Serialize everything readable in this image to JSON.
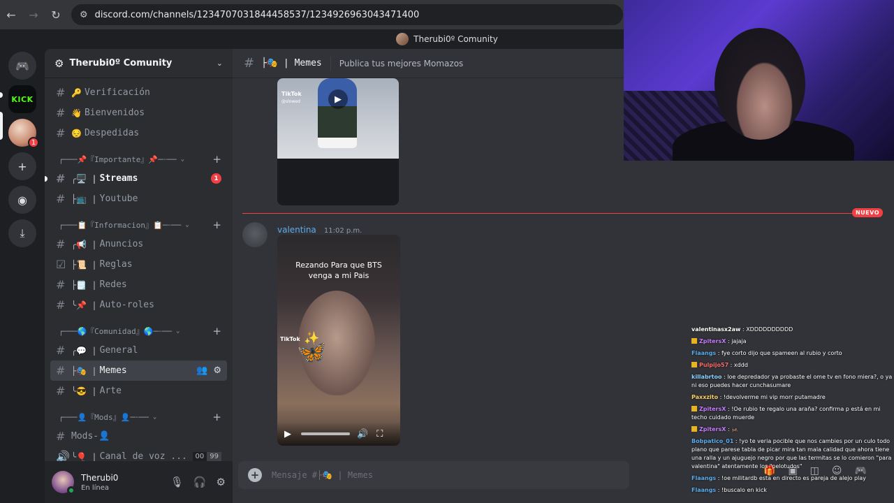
{
  "browser": {
    "url": "discord.com/channels/1234707031844458537/1234926963043471400"
  },
  "window": {
    "title": "Therubi0º Comunity"
  },
  "server": {
    "name": "Therubi0º Comunity"
  },
  "rail": {
    "kick_label": "KICK",
    "badge_count": "1"
  },
  "channels_top": [
    {
      "deco": "🔑",
      "name": "Verificación"
    },
    {
      "deco": "👋",
      "name": "Bienvenidos"
    },
    {
      "deco": "😔",
      "name": "Despedidas"
    }
  ],
  "categories": {
    "importante": "┌───📌『Importante』📌─┈──",
    "informacion": "┌───📋『Informacion』📋─┈──",
    "comunidad": "┌───🌎『Comunidad』🌎─┈──",
    "mods": "┌───👤『Mods』👤─┈──"
  },
  "channels_importante": [
    {
      "deco": "╭🖥️ |",
      "name": "Streams",
      "badge": "1"
    },
    {
      "deco": "├📺 |",
      "name": "Youtube"
    }
  ],
  "channels_informacion": [
    {
      "deco": "╭📢 |",
      "name": "Anuncios"
    },
    {
      "deco": "├📜 |",
      "name": "Reglas"
    },
    {
      "deco": "├🗒️ |",
      "name": "Redes"
    },
    {
      "deco": "╰📌 |",
      "name": "Auto-roles"
    }
  ],
  "channels_comunidad": [
    {
      "deco": "╭💬 |",
      "name": "General"
    },
    {
      "deco": "├🎭 |",
      "name": "Memes"
    },
    {
      "deco": "╰😎 |",
      "name": "Arte"
    }
  ],
  "channels_mods": [
    {
      "deco": "",
      "name": "Mods-👤"
    },
    {
      "deco": "╰🎈 |",
      "name": "Canal de voz ...",
      "count_a": "00",
      "count_b": "99"
    }
  ],
  "user": {
    "name": "Therubi0",
    "status": "En línea"
  },
  "chat": {
    "channel_name": "├🎭 | Memes",
    "topic": "Publica tus mejores Momazos",
    "new_label": "NUEVO",
    "tiktok_label": "TikTok",
    "tiktok_handle": "@slowed",
    "message": {
      "author": "valentina",
      "time": "11:02 p.m.",
      "video_caption_1": "Rezando Para que BTS",
      "video_caption_2": "venga a mi Pais"
    },
    "composer_placeholder": "Mensaje #├🎭 | Memes"
  },
  "stream_chat": [
    {
      "user": "valentinasx2aw",
      "color": "#ffffff",
      "text": "XDDDDDDDDDD",
      "badge": false
    },
    {
      "user": "ZpitersX",
      "color": "#c77dff",
      "text": "jajaja",
      "badge": true
    },
    {
      "user": "Flaangs",
      "color": "#5dadec",
      "text": "fye corto dijo que spameen al rubio y corto",
      "badge": false
    },
    {
      "user": "Pulpijo57",
      "color": "#ff6b6b",
      "text": "xddd",
      "badge": true
    },
    {
      "user": "killabrtoo",
      "color": "#8bd3ff",
      "text": "loe depredador ya probaste el ome tv en fono miera?, o ya ni eso puedes hacer cunchasumare",
      "badge": false
    },
    {
      "user": "Paxxzito",
      "color": "#ffd166",
      "text": "!devolverme mi vip morr putamadre",
      "badge": false
    },
    {
      "user": "ZpitersX",
      "color": "#c77dff",
      "text": "!Oe rubio te regalo una araña? confirma p está en mi techo cuidado muerde",
      "badge": true
    },
    {
      "user": "ZpitersX",
      "color": "#c77dff",
      "text": "🦗",
      "badge": true
    },
    {
      "user": "Bobpatico_01",
      "color": "#5dadec",
      "text": "!yo te veria pocible que nos cambies por un culo todo plano que parese tabla de picar mira tan mala calidad que ahora tiene una ralla y un ajuguejo negro por que las termitas se lo comieron \"para valentina\" atentamente los \"pelotudos\"",
      "badge": false
    },
    {
      "user": "Flaangs",
      "color": "#5dadec",
      "text": "!oe militardb esta en directo es pareja de alejo play",
      "badge": false
    },
    {
      "user": "Flaangs",
      "color": "#5dadec",
      "text": "!buscalo en kick",
      "badge": false
    }
  ]
}
